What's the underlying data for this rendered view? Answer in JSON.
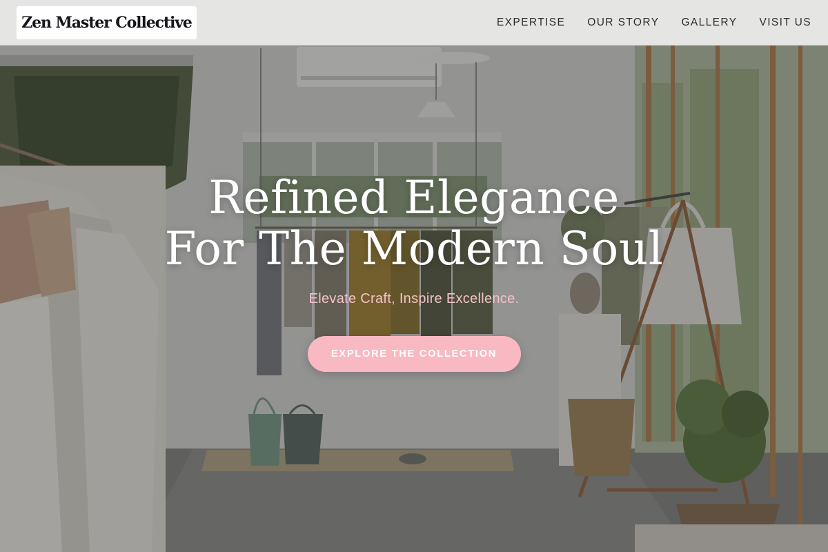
{
  "brand": {
    "name": "Zen Master Collective"
  },
  "nav": {
    "items": [
      {
        "label": "EXPERTISE"
      },
      {
        "label": "OUR STORY"
      },
      {
        "label": "GALLERY"
      },
      {
        "label": "VISIT US"
      }
    ]
  },
  "hero": {
    "headline_line1": "Refined Elegance",
    "headline_line2": "For The Modern Soul",
    "tagline": "Elevate Craft, Inspire Excellence.",
    "cta_label": "EXPLORE THE COLLECTION",
    "background_icon": "boutique-interior-photo"
  },
  "colors": {
    "accent": "#f9b9c3",
    "tagline": "#f4c2c9",
    "header_bg": "#ecece a",
    "text_dark": "#2c2c2c"
  }
}
